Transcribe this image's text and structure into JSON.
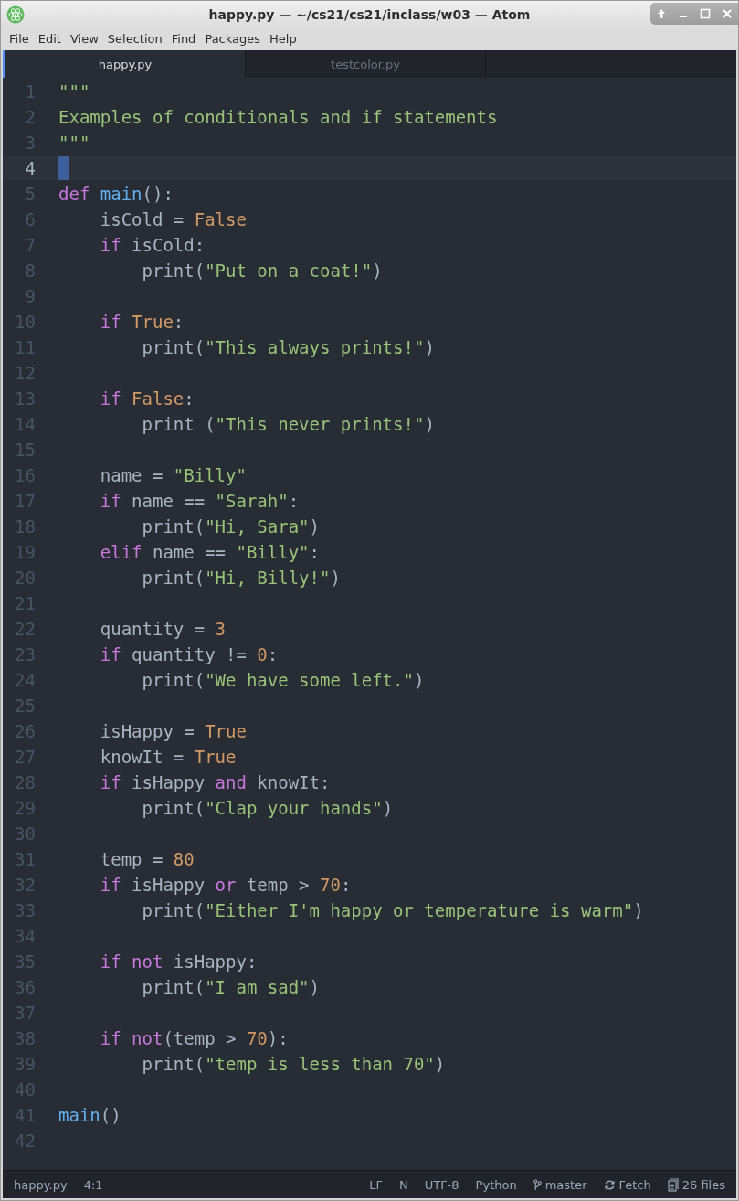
{
  "window": {
    "title": "happy.py — ~/cs21/cs21/inclass/w03 — Atom"
  },
  "menu": [
    "File",
    "Edit",
    "View",
    "Selection",
    "Find",
    "Packages",
    "Help"
  ],
  "tabs": [
    {
      "label": "happy.py",
      "selected": true
    },
    {
      "label": "testcolor.py",
      "selected": false
    }
  ],
  "lines": [
    {
      "number": "1",
      "current": false,
      "tokens": [
        {
          "kind": "string",
          "text": "\"\"\""
        }
      ]
    },
    {
      "number": "2",
      "current": false,
      "tokens": [
        {
          "kind": "string",
          "text": "Examples of conditionals and if statements"
        }
      ]
    },
    {
      "number": "3",
      "current": false,
      "tokens": [
        {
          "kind": "string",
          "text": "\"\"\""
        }
      ]
    },
    {
      "number": "4",
      "current": true
    },
    {
      "number": "5",
      "current": false,
      "tokens": [
        {
          "kind": "keyword",
          "text": "def "
        },
        {
          "kind": "function",
          "text": "main"
        },
        {
          "kind": "plain",
          "text": "():"
        }
      ]
    },
    {
      "number": "6",
      "current": false,
      "tokens": [
        {
          "kind": "plain",
          "text": "    isCold = "
        },
        {
          "kind": "constant",
          "text": "False"
        }
      ]
    },
    {
      "number": "7",
      "current": false,
      "tokens": [
        {
          "kind": "keyword",
          "text": "    if"
        },
        {
          "kind": "plain",
          "text": " isCold:"
        }
      ]
    },
    {
      "number": "8",
      "current": false,
      "tokens": [
        {
          "kind": "plain",
          "text": "        print("
        },
        {
          "kind": "string",
          "text": "\"Put on a coat!\""
        },
        {
          "kind": "plain",
          "text": ")"
        }
      ]
    },
    {
      "number": "9",
      "current": false
    },
    {
      "number": "10",
      "current": false,
      "tokens": [
        {
          "kind": "keyword",
          "text": "    if "
        },
        {
          "kind": "constant",
          "text": "True"
        },
        {
          "kind": "plain",
          "text": ":"
        }
      ]
    },
    {
      "number": "11",
      "current": false,
      "tokens": [
        {
          "kind": "plain",
          "text": "        print("
        },
        {
          "kind": "string",
          "text": "\"This always prints!\""
        },
        {
          "kind": "plain",
          "text": ")"
        }
      ]
    },
    {
      "number": "12",
      "current": false
    },
    {
      "number": "13",
      "current": false,
      "tokens": [
        {
          "kind": "keyword",
          "text": "    if "
        },
        {
          "kind": "constant",
          "text": "False"
        },
        {
          "kind": "plain",
          "text": ":"
        }
      ]
    },
    {
      "number": "14",
      "current": false,
      "tokens": [
        {
          "kind": "plain",
          "text": "        print ("
        },
        {
          "kind": "string",
          "text": "\"This never prints!\""
        },
        {
          "kind": "plain",
          "text": ")"
        }
      ]
    },
    {
      "number": "15",
      "current": false
    },
    {
      "number": "16",
      "current": false,
      "tokens": [
        {
          "kind": "plain",
          "text": "    name = "
        },
        {
          "kind": "string",
          "text": "\"Billy\""
        }
      ]
    },
    {
      "number": "17",
      "current": false,
      "tokens": [
        {
          "kind": "keyword",
          "text": "    if"
        },
        {
          "kind": "plain",
          "text": " name == "
        },
        {
          "kind": "string",
          "text": "\"Sarah\""
        },
        {
          "kind": "plain",
          "text": ":"
        }
      ]
    },
    {
      "number": "18",
      "current": false,
      "tokens": [
        {
          "kind": "plain",
          "text": "        print("
        },
        {
          "kind": "string",
          "text": "\"Hi, Sara\""
        },
        {
          "kind": "plain",
          "text": ")"
        }
      ]
    },
    {
      "number": "19",
      "current": false,
      "tokens": [
        {
          "kind": "keyword",
          "text": "    elif"
        },
        {
          "kind": "plain",
          "text": " name == "
        },
        {
          "kind": "string",
          "text": "\"Billy\""
        },
        {
          "kind": "plain",
          "text": ":"
        }
      ]
    },
    {
      "number": "20",
      "current": false,
      "tokens": [
        {
          "kind": "plain",
          "text": "        print("
        },
        {
          "kind": "string",
          "text": "\"Hi, Billy!\""
        },
        {
          "kind": "plain",
          "text": ")"
        }
      ]
    },
    {
      "number": "21",
      "current": false
    },
    {
      "number": "22",
      "current": false,
      "tokens": [
        {
          "kind": "plain",
          "text": "    quantity = "
        },
        {
          "kind": "constant",
          "text": "3"
        }
      ]
    },
    {
      "number": "23",
      "current": false,
      "tokens": [
        {
          "kind": "keyword",
          "text": "    if"
        },
        {
          "kind": "plain",
          "text": " quantity != "
        },
        {
          "kind": "constant",
          "text": "0"
        },
        {
          "kind": "plain",
          "text": ":"
        }
      ]
    },
    {
      "number": "24",
      "current": false,
      "tokens": [
        {
          "kind": "plain",
          "text": "        print("
        },
        {
          "kind": "string",
          "text": "\"We have some left.\""
        },
        {
          "kind": "plain",
          "text": ")"
        }
      ]
    },
    {
      "number": "25",
      "current": false
    },
    {
      "number": "26",
      "current": false,
      "tokens": [
        {
          "kind": "plain",
          "text": "    isHappy = "
        },
        {
          "kind": "constant",
          "text": "True"
        }
      ]
    },
    {
      "number": "27",
      "current": false,
      "tokens": [
        {
          "kind": "plain",
          "text": "    knowIt = "
        },
        {
          "kind": "constant",
          "text": "True"
        }
      ]
    },
    {
      "number": "28",
      "current": false,
      "tokens": [
        {
          "kind": "keyword",
          "text": "    if"
        },
        {
          "kind": "plain",
          "text": " isHappy "
        },
        {
          "kind": "keyword",
          "text": "and"
        },
        {
          "kind": "plain",
          "text": " knowIt:"
        }
      ]
    },
    {
      "number": "29",
      "current": false,
      "tokens": [
        {
          "kind": "plain",
          "text": "        print("
        },
        {
          "kind": "string",
          "text": "\"Clap your hands\""
        },
        {
          "kind": "plain",
          "text": ")"
        }
      ]
    },
    {
      "number": "30",
      "current": false
    },
    {
      "number": "31",
      "current": false,
      "tokens": [
        {
          "kind": "plain",
          "text": "    temp = "
        },
        {
          "kind": "constant",
          "text": "80"
        }
      ]
    },
    {
      "number": "32",
      "current": false,
      "tokens": [
        {
          "kind": "keyword",
          "text": "    if"
        },
        {
          "kind": "plain",
          "text": " isHappy "
        },
        {
          "kind": "keyword",
          "text": "or"
        },
        {
          "kind": "plain",
          "text": " temp > "
        },
        {
          "kind": "constant",
          "text": "70"
        },
        {
          "kind": "plain",
          "text": ":"
        }
      ]
    },
    {
      "number": "33",
      "current": false,
      "tokens": [
        {
          "kind": "plain",
          "text": "        print("
        },
        {
          "kind": "string",
          "text": "\"Either I'm happy or temperature is warm\""
        },
        {
          "kind": "plain",
          "text": ")"
        }
      ]
    },
    {
      "number": "34",
      "current": false
    },
    {
      "number": "35",
      "current": false,
      "tokens": [
        {
          "kind": "keyword",
          "text": "    if not"
        },
        {
          "kind": "plain",
          "text": " isHappy:"
        }
      ]
    },
    {
      "number": "36",
      "current": false,
      "tokens": [
        {
          "kind": "plain",
          "text": "        print("
        },
        {
          "kind": "string",
          "text": "\"I am sad\""
        },
        {
          "kind": "plain",
          "text": ")"
        }
      ]
    },
    {
      "number": "37",
      "current": false
    },
    {
      "number": "38",
      "current": false,
      "tokens": [
        {
          "kind": "keyword",
          "text": "    if not"
        },
        {
          "kind": "plain",
          "text": "(temp > "
        },
        {
          "kind": "constant",
          "text": "70"
        },
        {
          "kind": "plain",
          "text": "):"
        }
      ]
    },
    {
      "number": "39",
      "current": false,
      "tokens": [
        {
          "kind": "plain",
          "text": "        print("
        },
        {
          "kind": "string",
          "text": "\"temp is less than 70\""
        },
        {
          "kind": "plain",
          "text": ")"
        }
      ]
    },
    {
      "number": "40",
      "current": false
    },
    {
      "number": "41",
      "current": false,
      "tokens": [
        {
          "kind": "function",
          "text": "main"
        },
        {
          "kind": "plain",
          "text": "()"
        }
      ]
    },
    {
      "number": "42",
      "current": false
    }
  ],
  "status_bar": {
    "file": "happy.py",
    "cursor": "4:1",
    "line_ending": "LF",
    "mode": "N",
    "encoding": "UTF-8",
    "grammar": "Python",
    "branch": "master",
    "fetch": "Fetch",
    "files": "26 files"
  }
}
